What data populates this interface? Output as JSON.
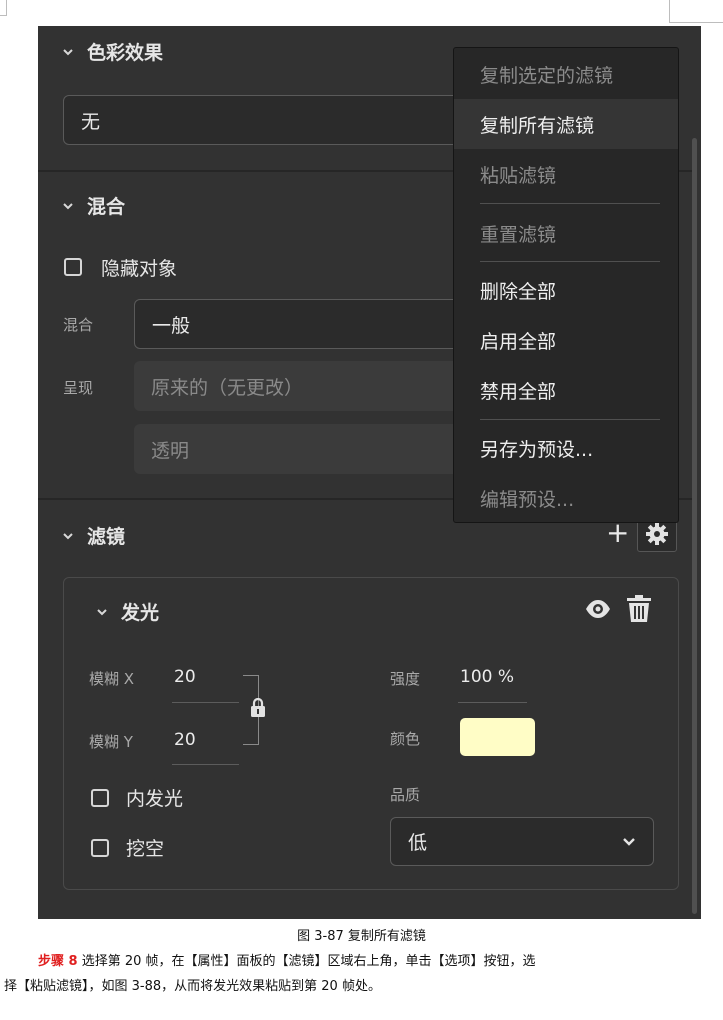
{
  "color_effect": {
    "title": "色彩效果",
    "value": "无"
  },
  "blend": {
    "title": "混合",
    "hide_object_label": "隐藏对象",
    "blend_label": "混合",
    "blend_value": "一般",
    "render_label": "呈现",
    "render_value": "原来的（无更改）",
    "transparent_value": "透明"
  },
  "filters": {
    "title": "滤镜",
    "add_symbol": "+",
    "glow": {
      "title": "发光",
      "blur_x_label": "模糊 X",
      "blur_x_value": "20",
      "blur_y_label": "模糊 Y",
      "blur_y_value": "20",
      "strength_label": "强度",
      "strength_value": "100 %",
      "color_label": "颜色",
      "color_value": "#fffdc6",
      "quality_label": "品质",
      "quality_value": "低",
      "inner_glow_label": "内发光",
      "knockout_label": "挖空"
    }
  },
  "menu": {
    "items": [
      {
        "label": "复制选定的滤镜",
        "enabled": false
      },
      {
        "label": "复制所有滤镜",
        "enabled": true,
        "highlighted": true
      },
      {
        "label": "粘贴滤镜",
        "enabled": false
      },
      {
        "label": "重置滤镜",
        "enabled": false
      },
      {
        "label": "删除全部",
        "enabled": true
      },
      {
        "label": "启用全部",
        "enabled": true
      },
      {
        "label": "禁用全部",
        "enabled": true
      },
      {
        "label": "另存为预设...",
        "enabled": true
      },
      {
        "label": "编辑预设...",
        "enabled": false
      }
    ]
  },
  "caption": {
    "figure": "图 3-87 复制所有滤镜",
    "step_label": "步骤 8",
    "line1": "选择第 20 帧，在【属性】面板的【滤镜】区域右上角，单击【选项】按钮，选",
    "line2": "择【粘贴滤镜】，如图 3-88，从而将发光效果粘贴到第 20 帧处。"
  }
}
